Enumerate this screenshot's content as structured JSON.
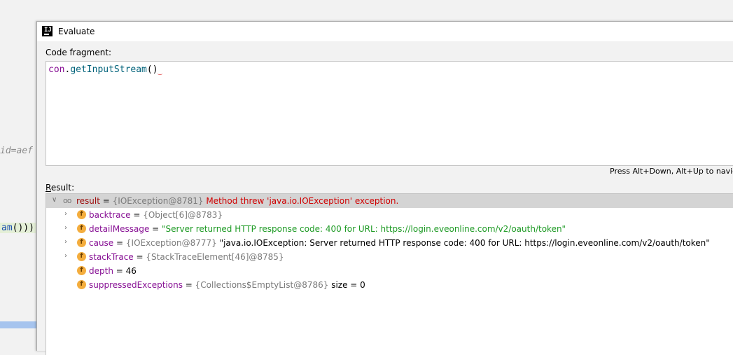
{
  "background": {
    "snippet_1": "id=aef",
    "snippet_2_method": "am",
    "snippet_2_parens": "()))"
  },
  "dialog": {
    "title": "Evaluate",
    "code_label": "Code fragment:",
    "code": {
      "var": "con",
      "dot": ".",
      "method": "getInputStream",
      "parens": "()"
    },
    "hint": "Press Alt+Down, Alt+Up to navigate",
    "result_label_mnemonic": "R",
    "result_label_rest": "esult:"
  },
  "result_tree": {
    "root": {
      "name": "result",
      "eq": " = ",
      "type": "{IOException@8781}",
      "message": "Method threw 'java.io.IOException' exception."
    },
    "fields": [
      {
        "badge": "f",
        "name": "backtrace",
        "eq": " = ",
        "type": "{Object[6]@8783}",
        "value": "",
        "expandable": true
      },
      {
        "badge": "f",
        "name": "detailMessage",
        "eq": " = ",
        "type": "",
        "value": "\"Server returned HTTP response code: 400 for URL: https://login.eveonline.com/v2/oauth/token\"",
        "expandable": true
      },
      {
        "badge": "f",
        "name": "cause",
        "eq": " = ",
        "type": "{IOException@8777}",
        "value": "\"java.io.IOException: Server returned HTTP response code: 400 for URL: https://login.eveonline.com/v2/oauth/token\"",
        "expandable": true
      },
      {
        "badge": "f",
        "name": "stackTrace",
        "eq": " = ",
        "type": "{StackTraceElement[46]@8785}",
        "value": "",
        "expandable": true
      },
      {
        "badge": "f",
        "name": "depth",
        "eq": " = ",
        "type": "",
        "value": "46",
        "expandable": false
      },
      {
        "badge": "f",
        "name": "suppressedExceptions",
        "eq": " = ",
        "type": "{Collections$EmptyList@8786}",
        "value": " size = 0",
        "expandable": false
      }
    ]
  },
  "icons": {
    "app": "intellij-icon",
    "expand": "chevron-right-icon",
    "collapse": "chevron-down-icon",
    "watch": "glasses-icon",
    "field": "field-icon"
  },
  "colors": {
    "field_badge": "#f4ad3d",
    "error_text": "#d00000",
    "string_value": "#1d9a24",
    "selection": "#d4d4d4"
  }
}
